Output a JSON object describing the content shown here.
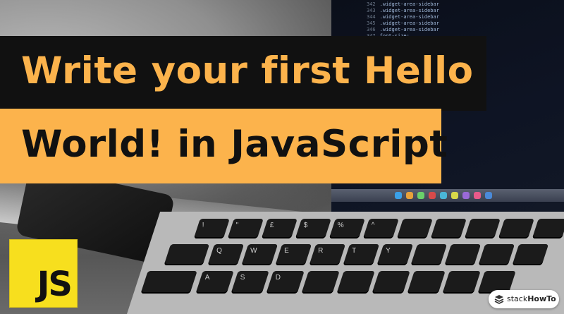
{
  "headline": {
    "line1": "Write your first Hello",
    "line2": "World! in JavaScript"
  },
  "logo": {
    "text": "JS"
  },
  "brand": {
    "name_part1": "stack",
    "name_part2": "HowTo"
  },
  "code_lines": [
    {
      "num": "342",
      "text": ".widget-area-sidebar"
    },
    {
      "num": "343",
      "text": ".widget-area-sidebar"
    },
    {
      "num": "344",
      "text": ".widget-area-sidebar"
    },
    {
      "num": "345",
      "text": ".widget-area-sidebar"
    },
    {
      "num": "346",
      "text": ".widget-area-sidebar"
    },
    {
      "num": "347",
      "text": "font-size:"
    }
  ],
  "keyboard_keys": [
    "!",
    "\"",
    "£",
    "$",
    "%",
    "^",
    "Q",
    "W",
    "E",
    "R",
    "T",
    "Y",
    "A",
    "S",
    "D"
  ],
  "colors": {
    "accent": "#fcb34c",
    "dark": "#111111",
    "js_yellow": "#f7df1e"
  }
}
